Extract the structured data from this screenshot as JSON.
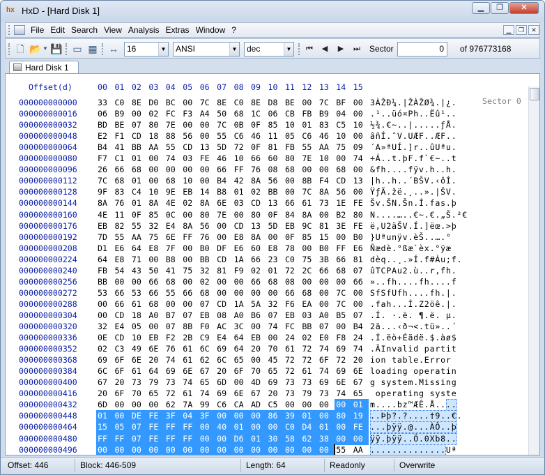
{
  "window": {
    "title": "HxD - [Hard Disk 1]"
  },
  "menu": {
    "items": [
      "File",
      "Edit",
      "Search",
      "View",
      "Analysis",
      "Extras",
      "Window",
      "?"
    ]
  },
  "toolbar": {
    "bytes_per_row": "16",
    "charset": "ANSI",
    "offset_base": "dec",
    "sector_label": "Sector",
    "sector_value": "0",
    "sector_total": "of 976773168"
  },
  "tab": {
    "label": "Hard Disk 1"
  },
  "editor": {
    "offset_header": "Offset(d)",
    "column_headers": [
      "00",
      "01",
      "02",
      "03",
      "04",
      "05",
      "06",
      "07",
      "08",
      "09",
      "10",
      "11",
      "12",
      "13",
      "14",
      "15"
    ],
    "sector_label": "Sector 0",
    "rows": [
      {
        "offset": "000000000000",
        "hex": [
          "33",
          "C0",
          "8E",
          "D0",
          "BC",
          "00",
          "7C",
          "8E",
          "C0",
          "8E",
          "D8",
          "BE",
          "00",
          "7C",
          "BF",
          "00"
        ],
        "text": "3ÀŽÐ¼.|ŽÀŽØ¾.|¿."
      },
      {
        "offset": "000000000016",
        "hex": [
          "06",
          "B9",
          "00",
          "02",
          "FC",
          "F3",
          "A4",
          "50",
          "68",
          "1C",
          "06",
          "CB",
          "FB",
          "B9",
          "04",
          "00"
        ],
        "text": ".¹..üó¤Ph..Ëû¹.."
      },
      {
        "offset": "000000000032",
        "hex": [
          "BD",
          "BE",
          "07",
          "80",
          "7E",
          "00",
          "00",
          "7C",
          "0B",
          "0F",
          "85",
          "10",
          "01",
          "83",
          "C5",
          "10"
        ],
        "text": "½¾.€~..|.....ƒÅ."
      },
      {
        "offset": "000000000048",
        "hex": [
          "E2",
          "F1",
          "CD",
          "18",
          "88",
          "56",
          "00",
          "55",
          "C6",
          "46",
          "11",
          "05",
          "C6",
          "46",
          "10",
          "00"
        ],
        "text": "âñÍ.ˆV.UÆF..ÆF.."
      },
      {
        "offset": "000000000064",
        "hex": [
          "B4",
          "41",
          "BB",
          "AA",
          "55",
          "CD",
          "13",
          "5D",
          "72",
          "0F",
          "81",
          "FB",
          "55",
          "AA",
          "75",
          "09"
        ],
        "text": "´A»ªUÍ.]r..ûUªu."
      },
      {
        "offset": "000000000080",
        "hex": [
          "F7",
          "C1",
          "01",
          "00",
          "74",
          "03",
          "FE",
          "46",
          "10",
          "66",
          "60",
          "80",
          "7E",
          "10",
          "00",
          "74"
        ],
        "text": "÷Á..t.þF.f`€~..t"
      },
      {
        "offset": "000000000096",
        "hex": [
          "26",
          "66",
          "68",
          "00",
          "00",
          "00",
          "00",
          "66",
          "FF",
          "76",
          "08",
          "68",
          "00",
          "00",
          "68",
          "00"
        ],
        "text": "&fh....fÿv.h..h."
      },
      {
        "offset": "000000000112",
        "hex": [
          "7C",
          "68",
          "01",
          "00",
          "68",
          "10",
          "00",
          "B4",
          "42",
          "8A",
          "56",
          "00",
          "8B",
          "F4",
          "CD",
          "13"
        ],
        "text": "|h..h..´BŠV.‹ôÍ."
      },
      {
        "offset": "000000000128",
        "hex": [
          "9F",
          "83",
          "C4",
          "10",
          "9E",
          "EB",
          "14",
          "B8",
          "01",
          "02",
          "BB",
          "00",
          "7C",
          "8A",
          "56",
          "00"
        ],
        "text": "ŸƒÄ.žë.¸..».|ŠV."
      },
      {
        "offset": "000000000144",
        "hex": [
          "8A",
          "76",
          "01",
          "8A",
          "4E",
          "02",
          "8A",
          "6E",
          "03",
          "CD",
          "13",
          "66",
          "61",
          "73",
          "1E",
          "FE"
        ],
        "text": "Šv.ŠN.Šn.Í.fas.þ"
      },
      {
        "offset": "000000000160",
        "hex": [
          "4E",
          "11",
          "0F",
          "85",
          "0C",
          "00",
          "80",
          "7E",
          "00",
          "80",
          "0F",
          "84",
          "8A",
          "00",
          "B2",
          "80"
        ],
        "text": "N....…..€~.€.„Š.²€"
      },
      {
        "offset": "000000000176",
        "hex": [
          "EB",
          "82",
          "55",
          "32",
          "E4",
          "8A",
          "56",
          "00",
          "CD",
          "13",
          "5D",
          "EB",
          "9C",
          "81",
          "3E",
          "FE"
        ],
        "text": "ë‚U2äŠV.Í.]ëœ.>þ"
      },
      {
        "offset": "000000000192",
        "hex": [
          "7D",
          "55",
          "AA",
          "75",
          "6E",
          "FF",
          "76",
          "00",
          "E8",
          "8A",
          "00",
          "0F",
          "85",
          "15",
          "00",
          "B0"
        ],
        "text": "}Uªunÿv.èŠ..….°"
      },
      {
        "offset": "000000000208",
        "hex": [
          "D1",
          "E6",
          "64",
          "E8",
          "7F",
          "00",
          "B0",
          "DF",
          "E6",
          "60",
          "E8",
          "78",
          "00",
          "B0",
          "FF",
          "E6"
        ],
        "text": "Ñædè.°ßæ`èx.°ÿæ"
      },
      {
        "offset": "000000000224",
        "hex": [
          "64",
          "E8",
          "71",
          "00",
          "B8",
          "00",
          "BB",
          "CD",
          "1A",
          "66",
          "23",
          "C0",
          "75",
          "3B",
          "66",
          "81"
        ],
        "text": "dèq..¸.»Í.f#Àu;f."
      },
      {
        "offset": "000000000240",
        "hex": [
          "FB",
          "54",
          "43",
          "50",
          "41",
          "75",
          "32",
          "81",
          "F9",
          "02",
          "01",
          "72",
          "2C",
          "66",
          "68",
          "07"
        ],
        "text": "ûTCPAu2.ù..r,fh."
      },
      {
        "offset": "000000000256",
        "hex": [
          "BB",
          "00",
          "00",
          "66",
          "68",
          "00",
          "02",
          "00",
          "00",
          "66",
          "68",
          "08",
          "00",
          "00",
          "00",
          "66"
        ],
        "text": "»..fh....fh....f"
      },
      {
        "offset": "000000000272",
        "hex": [
          "53",
          "66",
          "53",
          "66",
          "55",
          "66",
          "68",
          "00",
          "00",
          "00",
          "00",
          "66",
          "68",
          "00",
          "7C",
          "00"
        ],
        "text": "SfSfUfh....fh.|."
      },
      {
        "offset": "000000000288",
        "hex": [
          "00",
          "66",
          "61",
          "68",
          "00",
          "00",
          "07",
          "CD",
          "1A",
          "5A",
          "32",
          "F6",
          "EA",
          "00",
          "7C",
          "00"
        ],
        "text": ".fah...Í.Z2öê.|."
      },
      {
        "offset": "000000000304",
        "hex": [
          "00",
          "CD",
          "18",
          "A0",
          "B7",
          "07",
          "EB",
          "08",
          "A0",
          "B6",
          "07",
          "EB",
          "03",
          "A0",
          "B5",
          "07"
        ],
        "text": ".Í. ·.ë. ¶.ë. µ."
      },
      {
        "offset": "000000000320",
        "hex": [
          "32",
          "E4",
          "05",
          "00",
          "07",
          "8B",
          "F0",
          "AC",
          "3C",
          "00",
          "74",
          "FC",
          "BB",
          "07",
          "00",
          "B4"
        ],
        "text": "2ä...‹ð¬<.tü»..´"
      },
      {
        "offset": "000000000336",
        "hex": [
          "0E",
          "CD",
          "10",
          "EB",
          "F2",
          "2B",
          "C9",
          "E4",
          "64",
          "EB",
          "00",
          "24",
          "02",
          "E0",
          "F8",
          "24"
        ],
        "text": ".Í.ëò+Éädë.$.àø$"
      },
      {
        "offset": "000000000352",
        "hex": [
          "02",
          "C3",
          "49",
          "6E",
          "76",
          "61",
          "6C",
          "69",
          "64",
          "20",
          "70",
          "61",
          "72",
          "74",
          "69",
          "74"
        ],
        "text": ".ÃInvalid partit"
      },
      {
        "offset": "000000000368",
        "hex": [
          "69",
          "6F",
          "6E",
          "20",
          "74",
          "61",
          "62",
          "6C",
          "65",
          "00",
          "45",
          "72",
          "72",
          "6F",
          "72",
          "20"
        ],
        "text": "ion table.Error "
      },
      {
        "offset": "000000000384",
        "hex": [
          "6C",
          "6F",
          "61",
          "64",
          "69",
          "6E",
          "67",
          "20",
          "6F",
          "70",
          "65",
          "72",
          "61",
          "74",
          "69",
          "6E"
        ],
        "text": "loading operatin"
      },
      {
        "offset": "000000000400",
        "hex": [
          "67",
          "20",
          "73",
          "79",
          "73",
          "74",
          "65",
          "6D",
          "00",
          "4D",
          "69",
          "73",
          "73",
          "69",
          "6E",
          "67"
        ],
        "text": "g system.Missing"
      },
      {
        "offset": "000000000416",
        "hex": [
          "20",
          "6F",
          "70",
          "65",
          "72",
          "61",
          "74",
          "69",
          "6E",
          "67",
          "20",
          "73",
          "79",
          "73",
          "74",
          "65"
        ],
        "text": " operating syste"
      },
      {
        "offset": "000000000432",
        "hex": [
          "6D",
          "00",
          "00",
          "00",
          "62",
          "7A",
          "99",
          "C6",
          "CA",
          "AD",
          "C5",
          "00",
          "00",
          "00",
          "00",
          "01"
        ],
        "text": "m....bz™ÆÊ.Å...."
      },
      {
        "offset": "000000000448",
        "hex": [
          "01",
          "00",
          "DE",
          "FE",
          "3F",
          "04",
          "3F",
          "00",
          "00",
          "00",
          "86",
          "39",
          "01",
          "00",
          "80",
          "19"
        ],
        "text": "..Þþ?.?....†9..€."
      },
      {
        "offset": "000000000464",
        "hex": [
          "15",
          "05",
          "07",
          "FE",
          "FF",
          "FF",
          "00",
          "40",
          "01",
          "00",
          "00",
          "C0",
          "D4",
          "01",
          "00",
          "FE"
        ],
        "text": "...þÿÿ.@...ÀÔ..þ"
      },
      {
        "offset": "000000000480",
        "hex": [
          "FF",
          "FF",
          "07",
          "FE",
          "FF",
          "FF",
          "00",
          "00",
          "D6",
          "01",
          "30",
          "58",
          "62",
          "38",
          "00",
          "00"
        ],
        "text": "ÿÿ.þÿÿ..Ö.0Xb8.."
      },
      {
        "offset": "000000000496",
        "hex": [
          "00",
          "00",
          "00",
          "00",
          "00",
          "00",
          "00",
          "00",
          "00",
          "00",
          "00",
          "00",
          "00",
          "00",
          "55",
          "AA"
        ],
        "text": "..............Uª"
      }
    ]
  },
  "status": {
    "offset": "Offset: 446",
    "block": "Block: 446-509",
    "length": "Length: 64",
    "mode": "Readonly",
    "overwrite": "Overwrite"
  },
  "colors": {
    "offset_blue": "#0b1ea8",
    "selection": "#3399ff",
    "selection_text_bg": "#cde6ff"
  }
}
